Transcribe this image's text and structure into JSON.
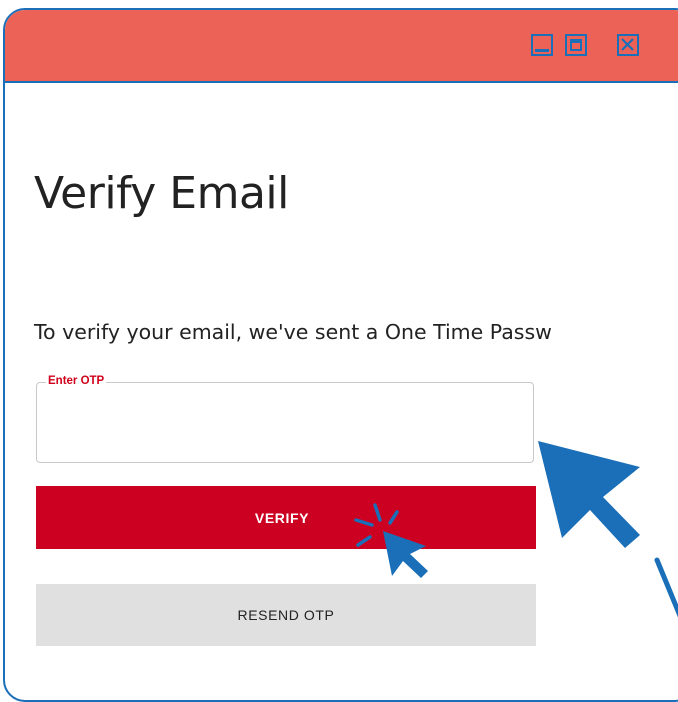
{
  "window": {
    "controls": [
      {
        "name": "minimize",
        "icon": "minimize-icon"
      },
      {
        "name": "maximize",
        "icon": "maximize-icon"
      },
      {
        "name": "close",
        "icon": "close-icon"
      }
    ]
  },
  "main": {
    "title": "Verify Email",
    "description": "To verify your email, we've sent a One Time Passw",
    "otp_label": "Enter OTP",
    "otp_value": "",
    "otp_placeholder": "",
    "verify_label": "VERIFY",
    "resend_label": "RESEND OTP"
  },
  "colors": {
    "titlebar": "#ec6256",
    "accent_blue": "#1a6fb8",
    "verify_button": "#cc0020",
    "resend_button": "#e0e0e0",
    "label_red": "#d0021b"
  }
}
